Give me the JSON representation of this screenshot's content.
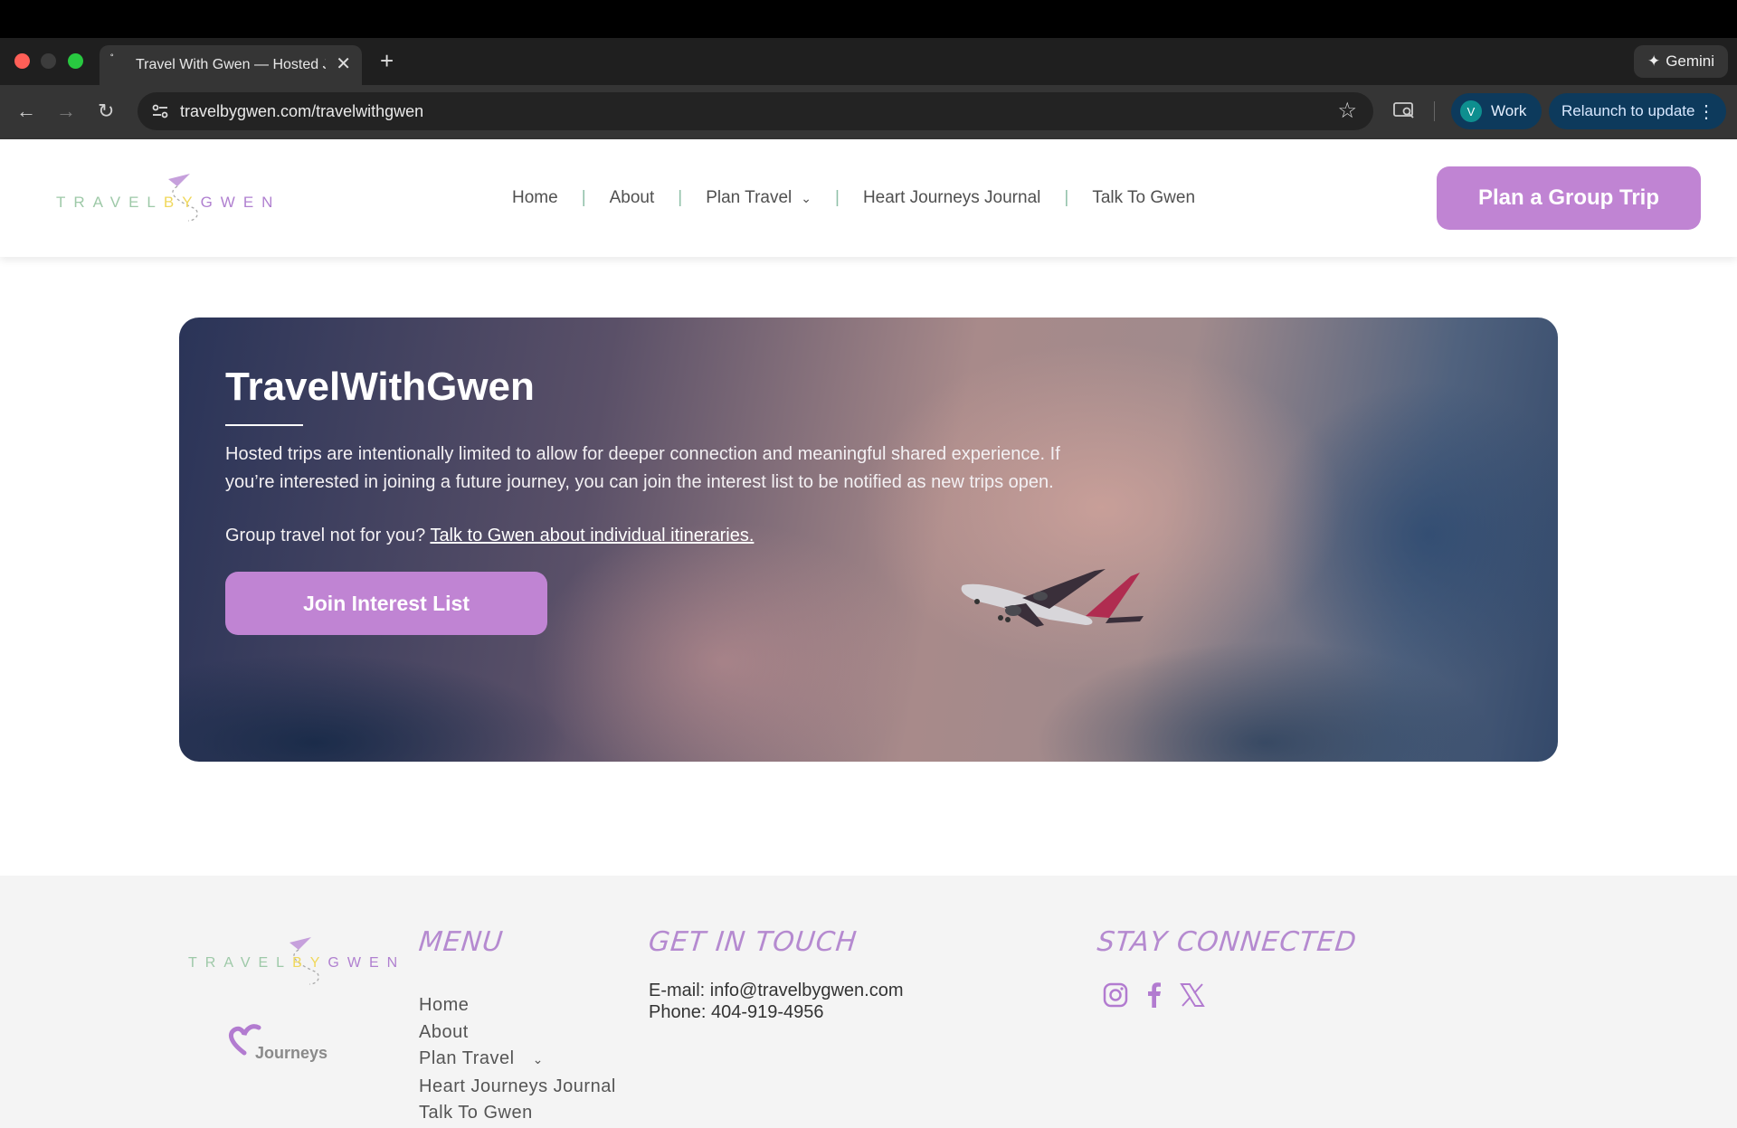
{
  "browser": {
    "tab_title": "Travel With Gwen — Hosted J",
    "url": "travelbygwen.com/travelwithgwen",
    "gemini_label": "Gemini",
    "profile_initial": "V",
    "profile_label": "Work",
    "relaunch_label": "Relaunch to update"
  },
  "header": {
    "logo": {
      "travel": "TRAVEL",
      "by": "BY",
      "gwen": "GWEN"
    },
    "nav": [
      "Home",
      "About",
      "Plan Travel",
      "Heart Journeys Journal",
      "Talk To Gwen"
    ],
    "cta_label": "Plan a Group Trip"
  },
  "hero": {
    "title": "TravelWithGwen",
    "paragraph": "Hosted trips are intentionally limited to allow for deeper connection and meaningful shared experience. If you’re interested in joining a future journey, you can join the interest list to be notified as new trips open.",
    "question": "Group travel not for you?",
    "link_text": "Talk to Gwen about individual itineraries.",
    "button_label": "Join Interest List"
  },
  "footer": {
    "journeys_logo_text": "Journeys",
    "menu_heading": "MENU",
    "menu_items": [
      "Home",
      "About",
      "Plan Travel",
      "Heart Journeys Journal",
      "Talk To Gwen"
    ],
    "contact_heading": "GET IN TOUCH",
    "email_line": "E-mail: info@travelbygwen.com",
    "phone_line": "Phone: 404-919-4956",
    "social_heading": "STAY CONNECTED"
  },
  "colors": {
    "accent_purple": "#c084d3",
    "heading_purple": "#b58ad0",
    "divider_green": "#8fc0a8"
  },
  "icons": [
    "instagram-icon",
    "facebook-icon",
    "x-icon",
    "star-icon",
    "cast-icon",
    "chevron-down-icon"
  ]
}
